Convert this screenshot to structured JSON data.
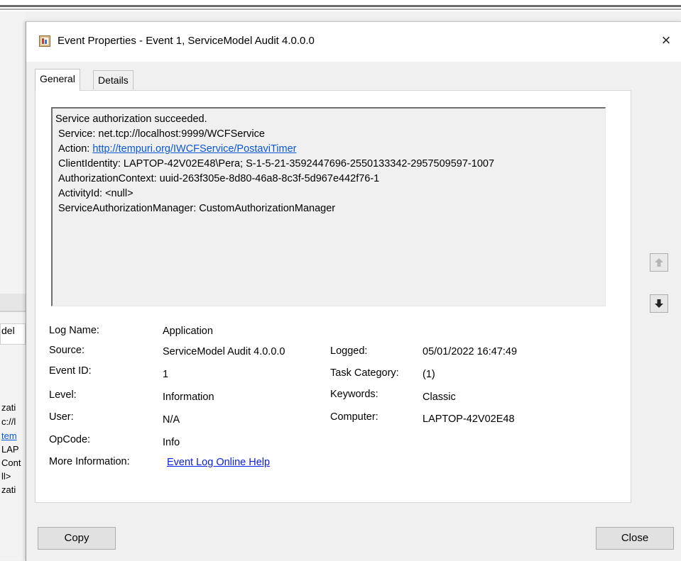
{
  "background_app": {
    "fragments": [
      "del",
      "zati",
      "c://l",
      "tem",
      "LAP",
      "Cont",
      "ll>",
      "zati"
    ]
  },
  "dialog": {
    "title": "Event Properties - Event 1, ServiceModel Audit 4.0.0.0",
    "close_glyph": "×",
    "title_icon": "event-viewer-icon"
  },
  "tabs": [
    {
      "label": "General",
      "active": true
    },
    {
      "label": "Details",
      "active": false
    }
  ],
  "message": {
    "line1": "Service authorization succeeded.",
    "service": "Service: net.tcp://localhost:9999/WCFService",
    "action_prefix": "Action: ",
    "action_link": "http://tempuri.org/IWCFService/PostaviTimer",
    "client_identity": "ClientIdentity: LAPTOP-42V02E48\\Pera; S-1-5-21-3592447696-2550133342-2957509597-1007",
    "authorization_context": "AuthorizationContext: uuid-263f305e-8d80-46a8-8c3f-5d967e442f76-1",
    "activity_id": "ActivityId: <null>",
    "auth_manager": "ServiceAuthorizationManager: CustomAuthorizationManager"
  },
  "fields": {
    "log_name_label": "Log Name:",
    "log_name": "Application",
    "source_label": "Source:",
    "source": "ServiceModel Audit 4.0.0.0",
    "logged_label": "Logged:",
    "logged": "05/01/2022 16:47:49",
    "event_id_label": "Event ID:",
    "event_id": "1",
    "task_category_label": "Task Category:",
    "task_category": "(1)",
    "level_label": "Level:",
    "level": "Information",
    "keywords_label": "Keywords:",
    "keywords": "Classic",
    "user_label": "User:",
    "user": "N/A",
    "computer_label": "Computer:",
    "computer": "LAPTOP-42V02E48",
    "opcode_label": "OpCode:",
    "opcode": "Info",
    "more_info_label": "More Information:",
    "more_info_link": "Event Log Online Help"
  },
  "nav": {
    "up_icon": "arrow-up-icon",
    "down_icon": "arrow-down-icon"
  },
  "buttons": {
    "copy": "Copy",
    "close": "Close"
  }
}
